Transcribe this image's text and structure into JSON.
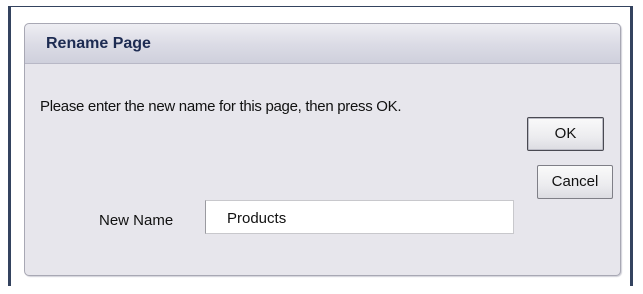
{
  "dialog": {
    "title": "Rename Page",
    "prompt": "Please enter the new name for this page, then press OK.",
    "ok_label": "OK",
    "cancel_label": "Cancel",
    "name_field": {
      "label": "New Name",
      "value": "Products"
    }
  }
}
